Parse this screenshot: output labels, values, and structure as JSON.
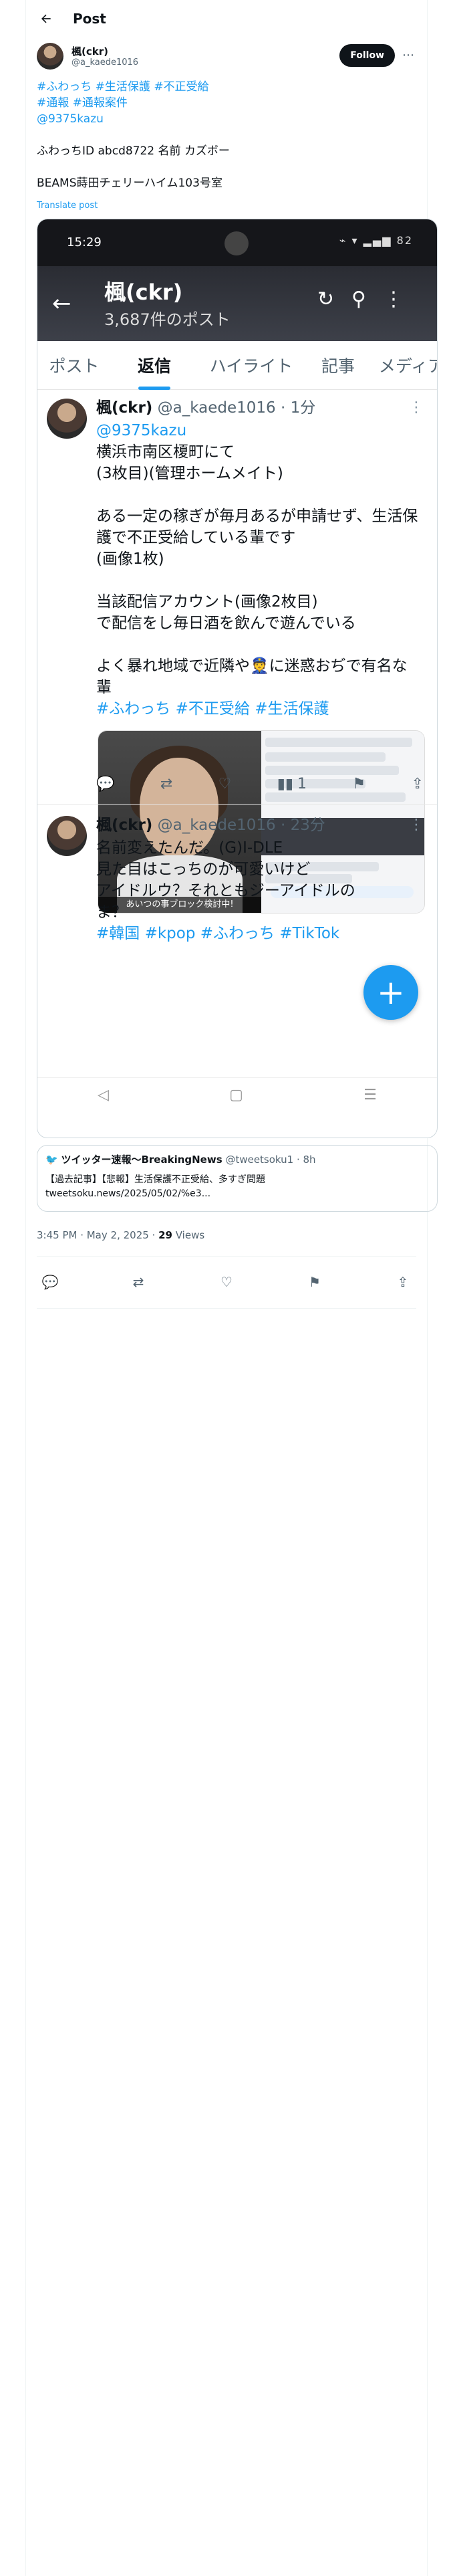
{
  "header": {
    "title": "Post"
  },
  "author": {
    "name": "楓(ckr)",
    "handle": "@a_kaede1016",
    "follow_label": "Follow",
    "more": "⋯"
  },
  "post": {
    "line1": {
      "tags": [
        "#ふわっち",
        "#生活保護",
        "#不正受給"
      ]
    },
    "line2": {
      "tags": [
        "#通報",
        "#通報案件"
      ]
    },
    "mention": "@9375kazu",
    "text1": "ふわっちID abcd8722 名前 カズボー",
    "text2": "BEAMS蒔田チェリーハイム103号室",
    "translate": "Translate post"
  },
  "screenshot": {
    "status_time": "15:29",
    "status_icons": "⌁ ▾ ▂▄▆ 82",
    "profile_name": "楓(ckr)",
    "post_count": "3,687件のポスト",
    "tabs": [
      "ポスト",
      "返信",
      "ハイライト",
      "記事",
      "メディア"
    ],
    "tweet1": {
      "name": "楓(ckr)",
      "meta": "@a_kaede1016 · 1分",
      "mention": "@9375kazu",
      "lines": [
        "横浜市南区榎町にて",
        "(3枚目)(管理ホームメイト)",
        "",
        "ある一定の稼ぎが毎月あるが申請せず、生活保",
        "護で不正受給している輩です",
        "(画像1枚)",
        "",
        "当該配信アカウント(画像2枚目)",
        "で配信をし毎日酒を飲んで遊んでいる",
        "",
        "よく暴れ地域で近隣や👮に迷惑おぢで有名な",
        "輩"
      ],
      "tags": [
        "#ふわっち",
        "#不正受給",
        "#生活保護"
      ],
      "image_caption": "あいつの事ブロック検討中!",
      "view_count": "1"
    },
    "tweet2": {
      "name": "楓(ckr)",
      "meta": "@a_kaede1016 · 23分",
      "lines": [
        "名前変えたんだ。(G)I-DLE",
        "見た目はこっちのが可愛いけど",
        "アイドルウ？それともジーアイドルの",
        "ま？"
      ],
      "tags": [
        "#韓国",
        "#kpop",
        "#ふわっち",
        "#TikTok"
      ]
    },
    "fab": "+",
    "nav": [
      "◁",
      "▢",
      "☰"
    ]
  },
  "quote": {
    "name": "ツイッター速報〜BreakingNews",
    "handle": "@tweetsoku1 · 8h",
    "line1": "【過去記事】【悲報】生活保護不正受給、多すぎ問題",
    "line2": "tweetsoku.news/2025/05/02/%e3..."
  },
  "meta": {
    "time": "3:45 PM · May 2, 2025 · ",
    "views_count": "29",
    "views_label": " Views"
  }
}
